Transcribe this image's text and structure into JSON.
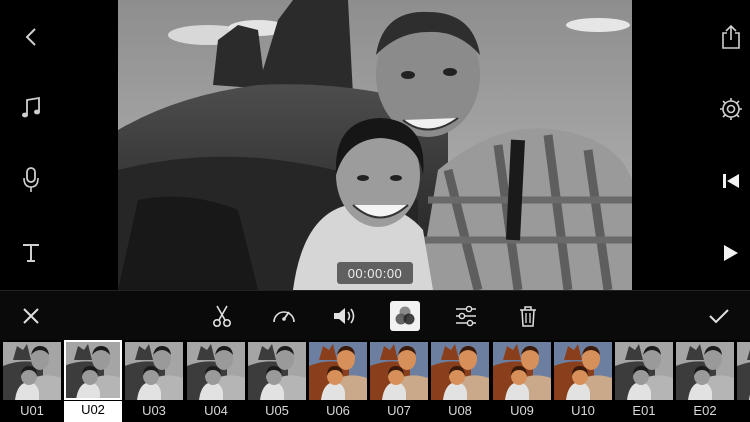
{
  "timecode": "00:00:00",
  "left_toolbar": [
    {
      "name": "back",
      "icon": "chevron-left-icon"
    },
    {
      "name": "music",
      "icon": "music-note-icon"
    },
    {
      "name": "voiceover",
      "icon": "microphone-icon"
    },
    {
      "name": "text",
      "icon": "text-icon"
    }
  ],
  "right_toolbar": [
    {
      "name": "share",
      "icon": "share-icon"
    },
    {
      "name": "settings",
      "icon": "gear-icon"
    },
    {
      "name": "skip-start",
      "icon": "skip-back-icon"
    },
    {
      "name": "play",
      "icon": "play-icon"
    }
  ],
  "edit_toolbar": [
    {
      "name": "close",
      "icon": "close-icon"
    },
    {
      "name": "cut",
      "icon": "scissors-icon"
    },
    {
      "name": "speed",
      "icon": "speedometer-icon"
    },
    {
      "name": "volume",
      "icon": "volume-icon"
    },
    {
      "name": "filter",
      "icon": "color-filter-icon",
      "active": true
    },
    {
      "name": "adjust",
      "icon": "sliders-icon"
    },
    {
      "name": "delete",
      "icon": "trash-icon"
    },
    {
      "name": "confirm",
      "icon": "checkmark-icon"
    }
  ],
  "filters": {
    "selected": "U02",
    "items": [
      {
        "label": "U01",
        "tone": "bw"
      },
      {
        "label": "U02",
        "tone": "bw"
      },
      {
        "label": "U03",
        "tone": "bw"
      },
      {
        "label": "U04",
        "tone": "bw"
      },
      {
        "label": "U05",
        "tone": "bw"
      },
      {
        "label": "U06",
        "tone": "warm"
      },
      {
        "label": "U07",
        "tone": "warm"
      },
      {
        "label": "U08",
        "tone": "warm"
      },
      {
        "label": "U09",
        "tone": "warm"
      },
      {
        "label": "U10",
        "tone": "warm"
      },
      {
        "label": "E01",
        "tone": "bw"
      },
      {
        "label": "E02",
        "tone": "bw"
      }
    ]
  },
  "colors": {
    "accent": "#ffffff",
    "background": "#000000",
    "icon": "#cfcfcf"
  }
}
